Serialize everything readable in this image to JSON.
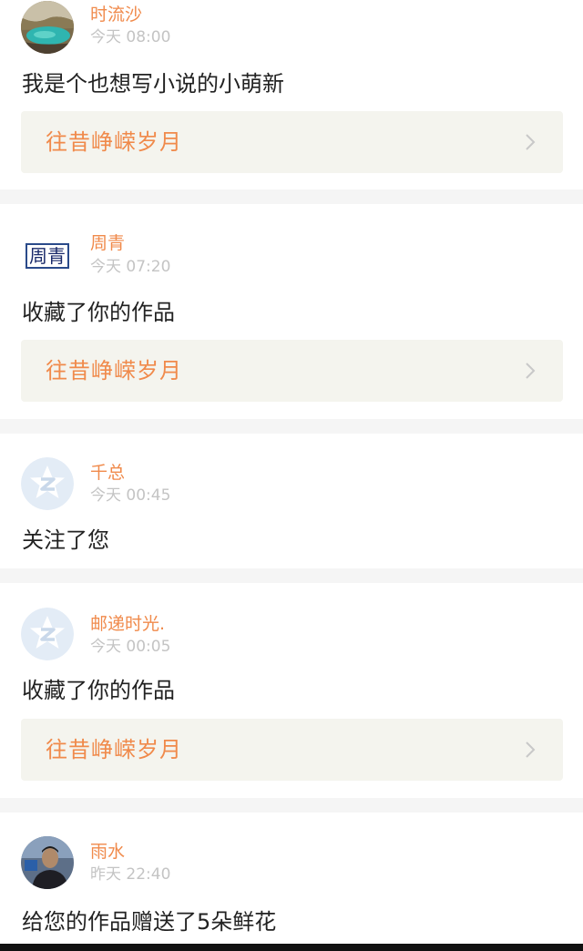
{
  "notifications": [
    {
      "username": "时流沙",
      "time": "今天 08:00",
      "message": "我是个也想写小说的小萌新",
      "work_title": "往昔峥嵘岁月",
      "avatar": "landscape-photo-avatar"
    },
    {
      "username": "周青",
      "time": "今天 07:20",
      "message": "收藏了你的作品",
      "work_title": "往昔峥嵘岁月",
      "avatar": "name-seal-avatar",
      "avatar_text": "周青"
    },
    {
      "username": "千总",
      "time": "今天 00:45",
      "message": "关注了您",
      "avatar": "default-qq-avatar"
    },
    {
      "username": "邮递时光.",
      "time": "今天 00:05",
      "message": "收藏了你的作品",
      "work_title": "往昔峥嵘岁月",
      "avatar": "default-qq-avatar"
    },
    {
      "username": "雨水",
      "time": "昨天 22:40",
      "message": "给您的作品赠送了5朵鲜花",
      "avatar": "person-photo-avatar"
    }
  ],
  "colors": {
    "accent": "#f08a4b",
    "time_gray": "#c4c4c4",
    "card_bg": "#f4f4ee",
    "separator": "#f5f5f5"
  }
}
